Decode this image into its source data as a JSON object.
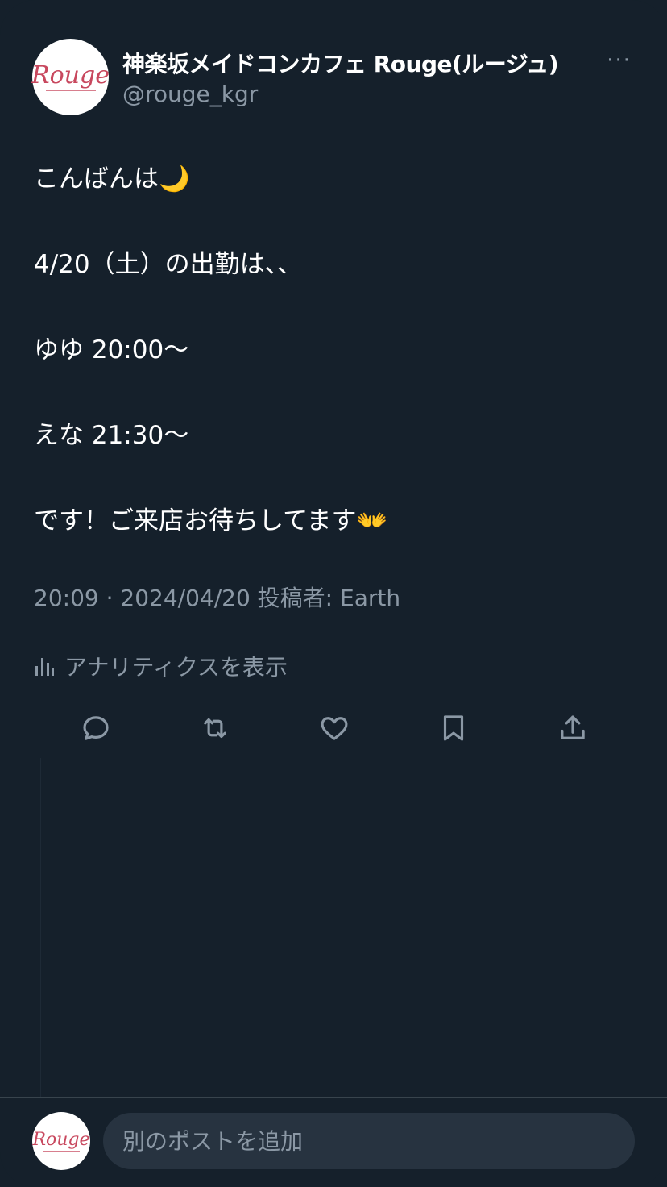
{
  "header": {
    "display_name": "神楽坂メイドコンカフェ Rouge(ルージュ)",
    "handle": "@rouge_kgr",
    "avatar_text": "Rouge",
    "more_label": "···"
  },
  "post": {
    "lines": [
      "こんばんは🌙",
      "4/20（土）の出勤は、、",
      "ゆゆ 20:00～",
      "えな 21:30～",
      "です！ご来店お待ちしてます👐"
    ],
    "meta": "20:09 · 2024/04/20 投稿者: Earth"
  },
  "analytics": {
    "label": "アナリティクスを表示"
  },
  "actions": [
    {
      "name": "reply-icon"
    },
    {
      "name": "repost-icon"
    },
    {
      "name": "like-icon"
    },
    {
      "name": "bookmark-icon"
    },
    {
      "name": "share-icon"
    }
  ],
  "composer": {
    "avatar_text": "Rouge",
    "placeholder": "別のポストを追加"
  },
  "colors": {
    "background": "#15202b",
    "secondary_text": "#8b98a5",
    "divider": "#38444d",
    "input_bg": "#273340",
    "brand": "#c8485e"
  }
}
